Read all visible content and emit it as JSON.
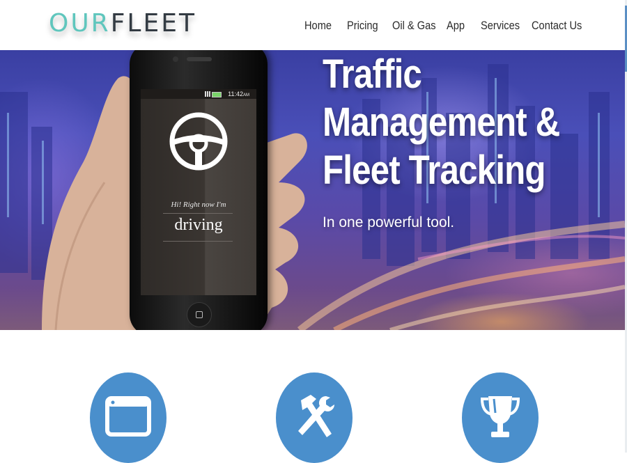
{
  "header": {
    "logo_our": "OUR",
    "logo_fleet": "FLEET"
  },
  "nav": {
    "items": [
      {
        "label": "Home"
      },
      {
        "label": "Pricing"
      },
      {
        "label": "Oil & Gas"
      },
      {
        "label": "App"
      },
      {
        "label": "Services"
      },
      {
        "label": "Contact Us"
      }
    ]
  },
  "hero": {
    "title_lines": [
      "Traffic",
      "Management &",
      "Fleet Tracking"
    ],
    "subtitle": "In one powerful tool."
  },
  "phone": {
    "time": "11:42",
    "time_suffix": "AM",
    "greeting": "Hi! Right now I'm",
    "status": "driving"
  },
  "features": [
    {
      "icon": "browser-window-icon"
    },
    {
      "icon": "hammer-wrench-icon"
    },
    {
      "icon": "trophy-icon"
    }
  ],
  "colors": {
    "logo_accent": "#5fc6bd",
    "logo_dark": "#333b43",
    "feature_circle": "#4a8fcc",
    "scrollbar": "#5a8fc4"
  }
}
